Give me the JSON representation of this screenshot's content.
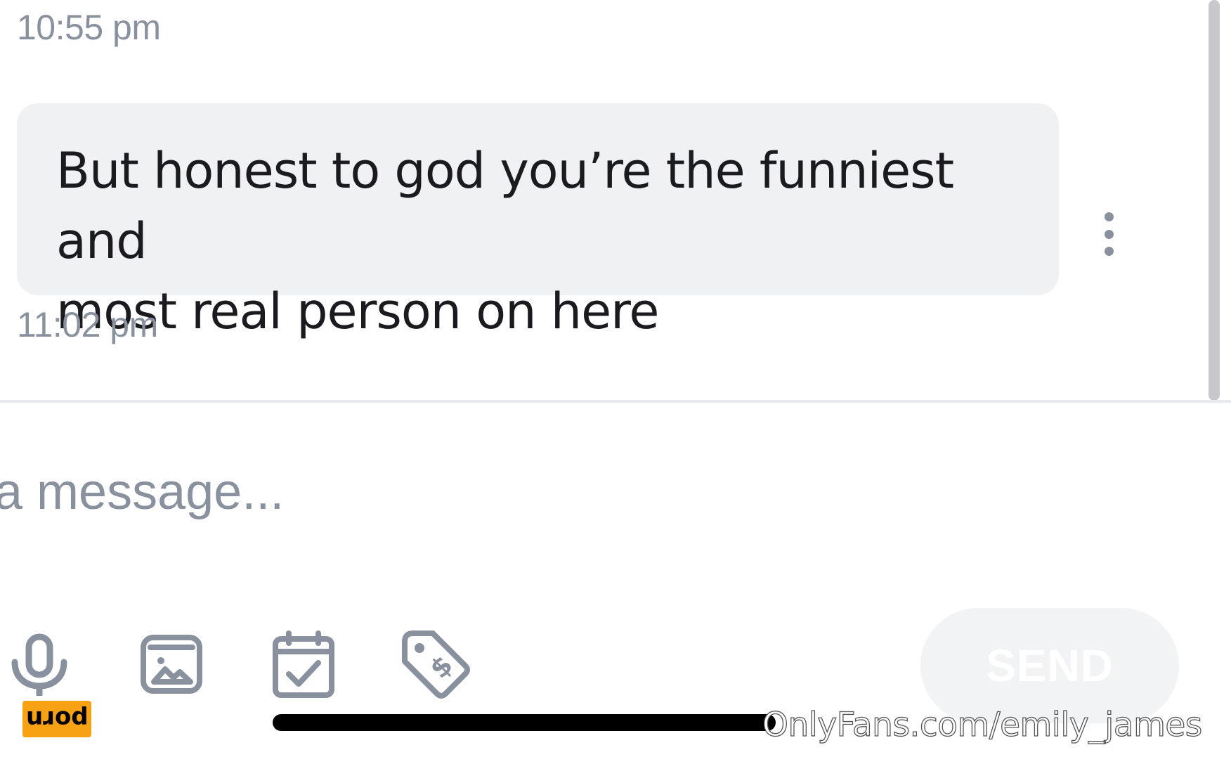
{
  "conversation": {
    "timestamps": [
      "10:55 pm",
      "11:02 pm"
    ],
    "message": {
      "line1": "But honest to god you’re the funniest and",
      "line2": "most real person on here"
    }
  },
  "composer": {
    "placeholder": "a message...",
    "send_label": "SEND",
    "tools": [
      "microphone-icon",
      "image-icon",
      "calendar-check-icon",
      "price-tag-icon"
    ]
  },
  "badge": {
    "text": "porn"
  },
  "watermark": {
    "text": "OnlyFans.com/emily_james"
  },
  "colors": {
    "bubble_bg": "#f0f1f3",
    "muted_text": "#8a919e",
    "icon_gray": "#8a919e",
    "badge_bg": "#f7a213"
  }
}
